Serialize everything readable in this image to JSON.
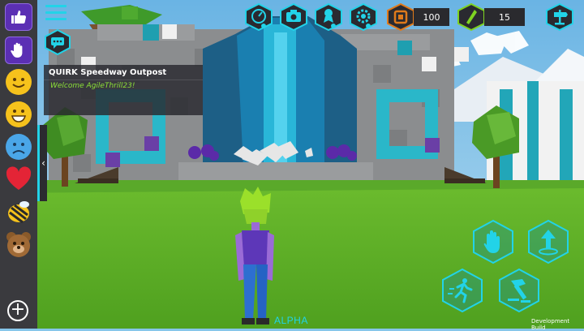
{
  "chat": {
    "title": "QUIRK Speedway Outpost",
    "message": "Welcome AgileThrill23!"
  },
  "currency": {
    "coins": "100",
    "gems": "15"
  },
  "player": {
    "label": "ALPHA"
  },
  "build_label": "Development Build",
  "emotes": [
    "thumbs-up",
    "wave-hand",
    "smile",
    "grin",
    "sad",
    "heart",
    "bee",
    "bear"
  ],
  "colors": {
    "accent": "#22d3e8",
    "emote_bar": "#3a3a3e",
    "purple_slot": "#5b2fb4",
    "grass": "#5fb128",
    "chat_text": "#8be037"
  },
  "icons": {
    "top": [
      "speedometer-icon",
      "camera-icon",
      "badge-icon",
      "settings-icon",
      "coin-icon",
      "gem-icon",
      "map-signpost-icon"
    ],
    "actions": [
      "interact-hand-icon",
      "teleport-up-icon",
      "sprint-icon",
      "hammer-build-icon"
    ]
  }
}
